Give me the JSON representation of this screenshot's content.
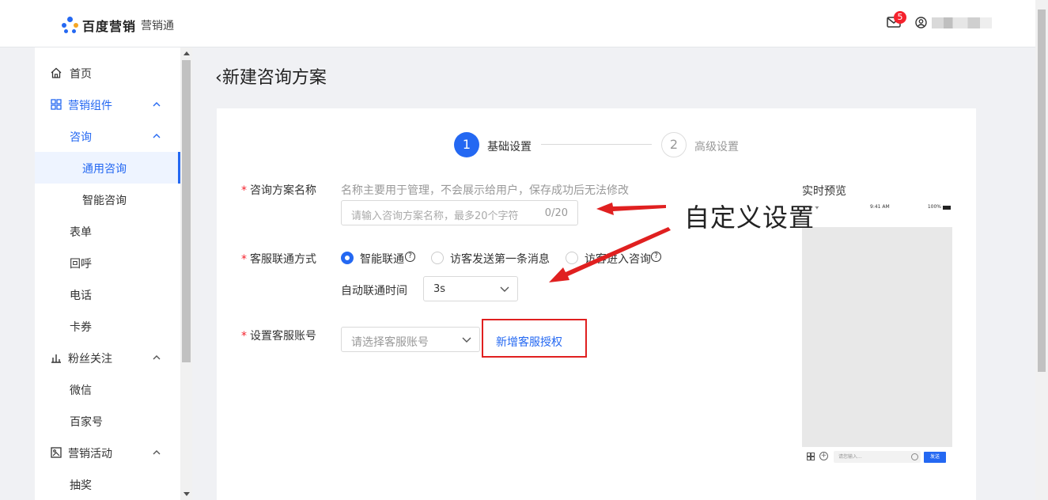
{
  "header": {
    "brand": "百度营销",
    "product": "营销通",
    "mail_count": "5"
  },
  "sidebar": {
    "items": [
      {
        "label": "首页",
        "icon": "home-icon"
      },
      {
        "label": "营销组件",
        "icon": "grid-icon"
      },
      {
        "label": "咨询"
      },
      {
        "label": "通用咨询"
      },
      {
        "label": "智能咨询"
      },
      {
        "label": "表单"
      },
      {
        "label": "回呼"
      },
      {
        "label": "电话"
      },
      {
        "label": "卡券"
      },
      {
        "label": "粉丝关注",
        "icon": "bar-chart-icon"
      },
      {
        "label": "微信"
      },
      {
        "label": "百家号"
      },
      {
        "label": "营销活动",
        "icon": "image-icon"
      },
      {
        "label": "抽奖"
      }
    ]
  },
  "page": {
    "title": "新建咨询方案",
    "steps": [
      {
        "num": "1",
        "label": "基础设置"
      },
      {
        "num": "2",
        "label": "高级设置"
      }
    ]
  },
  "form": {
    "name_label": "咨询方案名称",
    "name_hint": "名称主要用于管理，不会展示给用户，保存成功后无法修改",
    "name_placeholder": "请输入咨询方案名称，最多20个字符",
    "name_count": "0/20",
    "connect_label": "客服联通方式",
    "connect_options": [
      "智能联通",
      "访客发送第一条消息",
      "访客进入咨询"
    ],
    "auto_time_label": "自动联通时间",
    "auto_time_value": "3s",
    "account_label": "设置客服账号",
    "account_placeholder": "请选择客服账号",
    "add_auth": "新增客服授权"
  },
  "preview": {
    "title": "实时预览",
    "status_time": "9:41 AM",
    "status_battery": "100%",
    "input_placeholder": "请您输入...",
    "send": "发送"
  },
  "annotation": {
    "text": "自定义设置"
  },
  "colors": {
    "accent": "#2468f2",
    "annotation_red": "#e02020"
  }
}
